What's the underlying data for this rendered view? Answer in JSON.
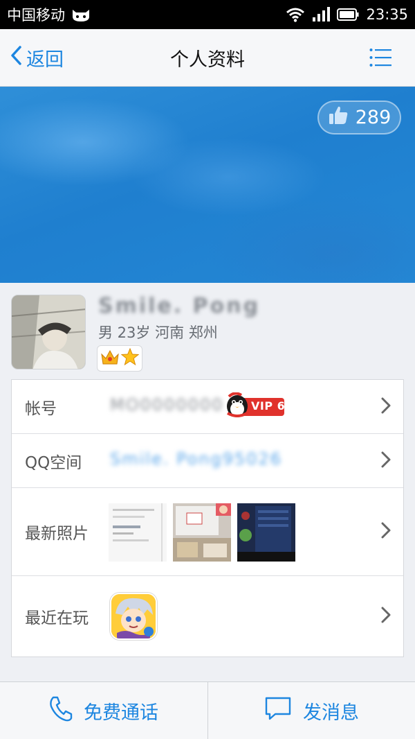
{
  "status_bar": {
    "carrier": "中国移动",
    "time": "23:35",
    "icons": [
      "cat-icon",
      "wifi-icon",
      "signal-icon",
      "battery-icon"
    ]
  },
  "nav": {
    "back_label": "返回",
    "title": "个人资料",
    "menu_icon": "list-menu-icon"
  },
  "banner": {
    "like_count": "289",
    "like_icon": "thumbs-up-icon"
  },
  "profile": {
    "name": "Smile. Pong",
    "meta": "男 23岁 河南 郑州",
    "badges": [
      "crown-icon",
      "star-icon"
    ]
  },
  "info": {
    "account": {
      "label": "帐号",
      "value": "MO0000000",
      "vip_label": "VIP 6"
    },
    "qzone": {
      "label": "QQ空间",
      "value": "Smile. Pong95026"
    },
    "photos": {
      "label": "最新照片"
    },
    "games": {
      "label": "最近在玩"
    }
  },
  "actions": {
    "call_label": "免费通话",
    "message_label": "发消息"
  },
  "colors": {
    "accent": "#1d86e0",
    "banner": "#2488d5",
    "vip": "#e0322c"
  }
}
